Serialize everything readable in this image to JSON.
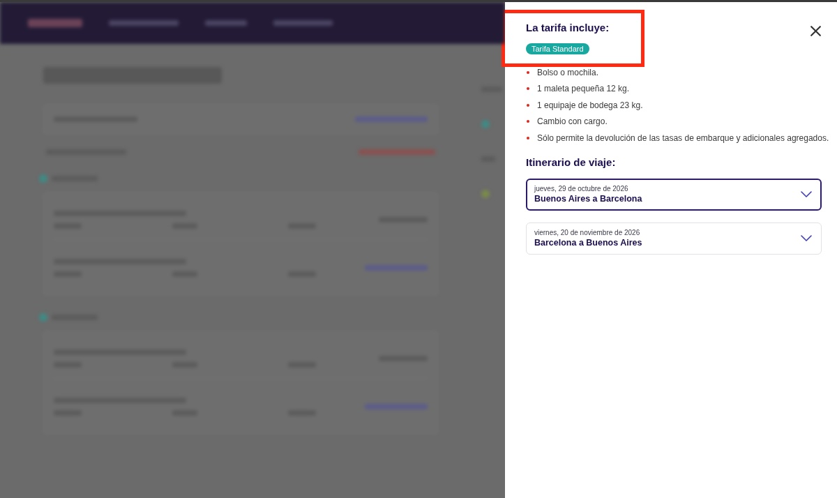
{
  "fare_panel": {
    "title": "La tarifa incluye:",
    "highlighted": true,
    "badge": "Tarifa Standard",
    "inclusions": [
      "Bolso o mochila.",
      "1 maleta pequeña 12 kg.",
      "1 equipaje de bodega 23 kg.",
      "Cambio con cargo.",
      "Sólo permite la devolución de las tasas de embarque y adicionales agregados."
    ]
  },
  "itinerary": {
    "title": "Itinerario de viaje:",
    "legs": [
      {
        "date": "jueves, 29 de octubre de 2026",
        "route": "Buenos Aires a Barcelona",
        "selected": true
      },
      {
        "date": "viernes, 20 de noviembre de 2026",
        "route": "Barcelona a Buenos Aires",
        "selected": false
      }
    ]
  }
}
